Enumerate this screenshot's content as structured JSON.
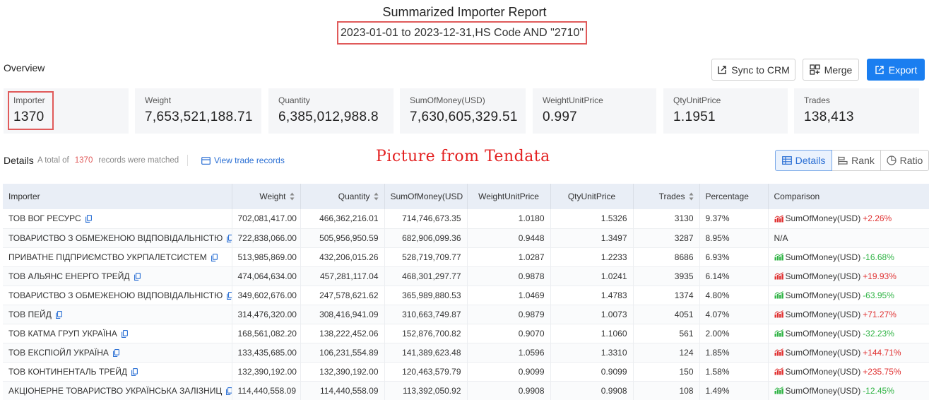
{
  "header": {
    "title": "Summarized Importer Report",
    "subtitle": "2023-01-01 to 2023-12-31,HS Code AND \"2710\""
  },
  "overview": {
    "label": "Overview",
    "buttons": {
      "sync": "Sync to CRM",
      "merge": "Merge",
      "export": "Export"
    },
    "stats": [
      {
        "label": "Importer",
        "value": "1370"
      },
      {
        "label": "Weight",
        "value": "7,653,521,188.71"
      },
      {
        "label": "Quantity",
        "value": "6,385,012,988.8"
      },
      {
        "label": "SumOfMoney(USD)",
        "value": "7,630,605,329.51"
      },
      {
        "label": "WeightUnitPrice",
        "value": "0.997"
      },
      {
        "label": "QtyUnitPrice",
        "value": "1.1951"
      },
      {
        "label": "Trades",
        "value": "138,413"
      }
    ]
  },
  "details": {
    "label": "Details",
    "info_prefix": "A total of",
    "count": "1370",
    "info_suffix": "records were matched",
    "view_records": "View trade records",
    "watermark": "Picture from Tendata",
    "tabs": [
      "Details",
      "Rank",
      "Ratio"
    ]
  },
  "table": {
    "columns": [
      "Importer",
      "Weight",
      "Quantity",
      "SumOfMoney(USD",
      "WeightUnitPrice",
      "QtyUnitPrice",
      "Trades",
      "Percentage",
      "Comparison"
    ],
    "rows": [
      {
        "importer": "ТОВ ВОГ РЕСУРС",
        "weight": "702,081,417.00",
        "quantity": "466,362,216.01",
        "sum": "714,746,673.35",
        "wup": "1.0180",
        "qup": "1.5326",
        "trades": "3130",
        "pct": "9.37%",
        "cmp_label": "SumOfMoney(USD)",
        "cmp_change": "+2.26%",
        "cmp_dir": "up"
      },
      {
        "importer": "ТОВАРИСТВО З ОБМЕЖЕНОЮ ВІДПОВІДАЛЬНІСТЮ",
        "weight": "722,838,066.00",
        "quantity": "505,956,950.59",
        "sum": "682,906,099.36",
        "wup": "0.9448",
        "qup": "1.3497",
        "trades": "3287",
        "pct": "8.95%",
        "cmp_label": "N/A",
        "cmp_change": "",
        "cmp_dir": "none"
      },
      {
        "importer": "ПРИВАТНЕ ПІДПРИЄМСТВО УКРПАЛЕТСИСТЕМ",
        "weight": "513,985,869.00",
        "quantity": "432,206,015.26",
        "sum": "528,719,709.77",
        "wup": "1.0287",
        "qup": "1.2233",
        "trades": "8686",
        "pct": "6.93%",
        "cmp_label": "SumOfMoney(USD)",
        "cmp_change": "-16.68%",
        "cmp_dir": "down"
      },
      {
        "importer": "ТОВ АЛЬЯНС ЕНЕРГО ТРЕЙД",
        "weight": "474,064,634.00",
        "quantity": "457,281,117.04",
        "sum": "468,301,297.77",
        "wup": "0.9878",
        "qup": "1.0241",
        "trades": "3935",
        "pct": "6.14%",
        "cmp_label": "SumOfMoney(USD)",
        "cmp_change": "+19.93%",
        "cmp_dir": "up"
      },
      {
        "importer": "ТОВАРИСТВО З ОБМЕЖЕНОЮ ВІДПОВІДАЛЬНІСТЮ",
        "weight": "349,602,676.00",
        "quantity": "247,578,621.62",
        "sum": "365,989,880.53",
        "wup": "1.0469",
        "qup": "1.4783",
        "trades": "1374",
        "pct": "4.80%",
        "cmp_label": "SumOfMoney(USD)",
        "cmp_change": "-63.95%",
        "cmp_dir": "down"
      },
      {
        "importer": "ТОВ ПЕЙД",
        "weight": "314,476,320.00",
        "quantity": "308,416,941.09",
        "sum": "310,663,749.87",
        "wup": "0.9879",
        "qup": "1.0073",
        "trades": "4051",
        "pct": "4.07%",
        "cmp_label": "SumOfMoney(USD)",
        "cmp_change": "+71.27%",
        "cmp_dir": "up"
      },
      {
        "importer": "ТОВ КАТМА ГРУП УКРАЇНА",
        "weight": "168,561,082.20",
        "quantity": "138,222,452.06",
        "sum": "152,876,700.82",
        "wup": "0.9070",
        "qup": "1.1060",
        "trades": "561",
        "pct": "2.00%",
        "cmp_label": "SumOfMoney(USD)",
        "cmp_change": "-32.23%",
        "cmp_dir": "down"
      },
      {
        "importer": "ТОВ ЕКСПІОЙЛ УКРАЇНА",
        "weight": "133,435,685.00",
        "quantity": "106,231,554.89",
        "sum": "141,389,623.48",
        "wup": "1.0596",
        "qup": "1.3310",
        "trades": "124",
        "pct": "1.85%",
        "cmp_label": "SumOfMoney(USD)",
        "cmp_change": "+144.71%",
        "cmp_dir": "up"
      },
      {
        "importer": "ТОВ КОНТИНЕНТАЛЬ ТРЕЙД",
        "weight": "132,390,192.00",
        "quantity": "132,390,192.00",
        "sum": "120,463,579.79",
        "wup": "0.9099",
        "qup": "0.9099",
        "trades": "150",
        "pct": "1.58%",
        "cmp_label": "SumOfMoney(USD)",
        "cmp_change": "+235.75%",
        "cmp_dir": "up"
      },
      {
        "importer": "АКЦІОНЕРНЕ ТОВАРИСТВО УКРАЇНСЬКА ЗАЛІЗНИЦ",
        "weight": "114,440,558.09",
        "quantity": "114,440,558.09",
        "sum": "113,392,050.92",
        "wup": "0.9908",
        "qup": "0.9908",
        "trades": "108",
        "pct": "1.49%",
        "cmp_label": "SumOfMoney(USD)",
        "cmp_change": "-12.45%",
        "cmp_dir": "down"
      }
    ]
  },
  "colors": {
    "accent": "#1a7ef0",
    "link": "#2a6fd4",
    "highlight": "#e05a5a",
    "positive": "#e03131",
    "negative": "#2fb344",
    "header_bg": "#e9eef6"
  }
}
